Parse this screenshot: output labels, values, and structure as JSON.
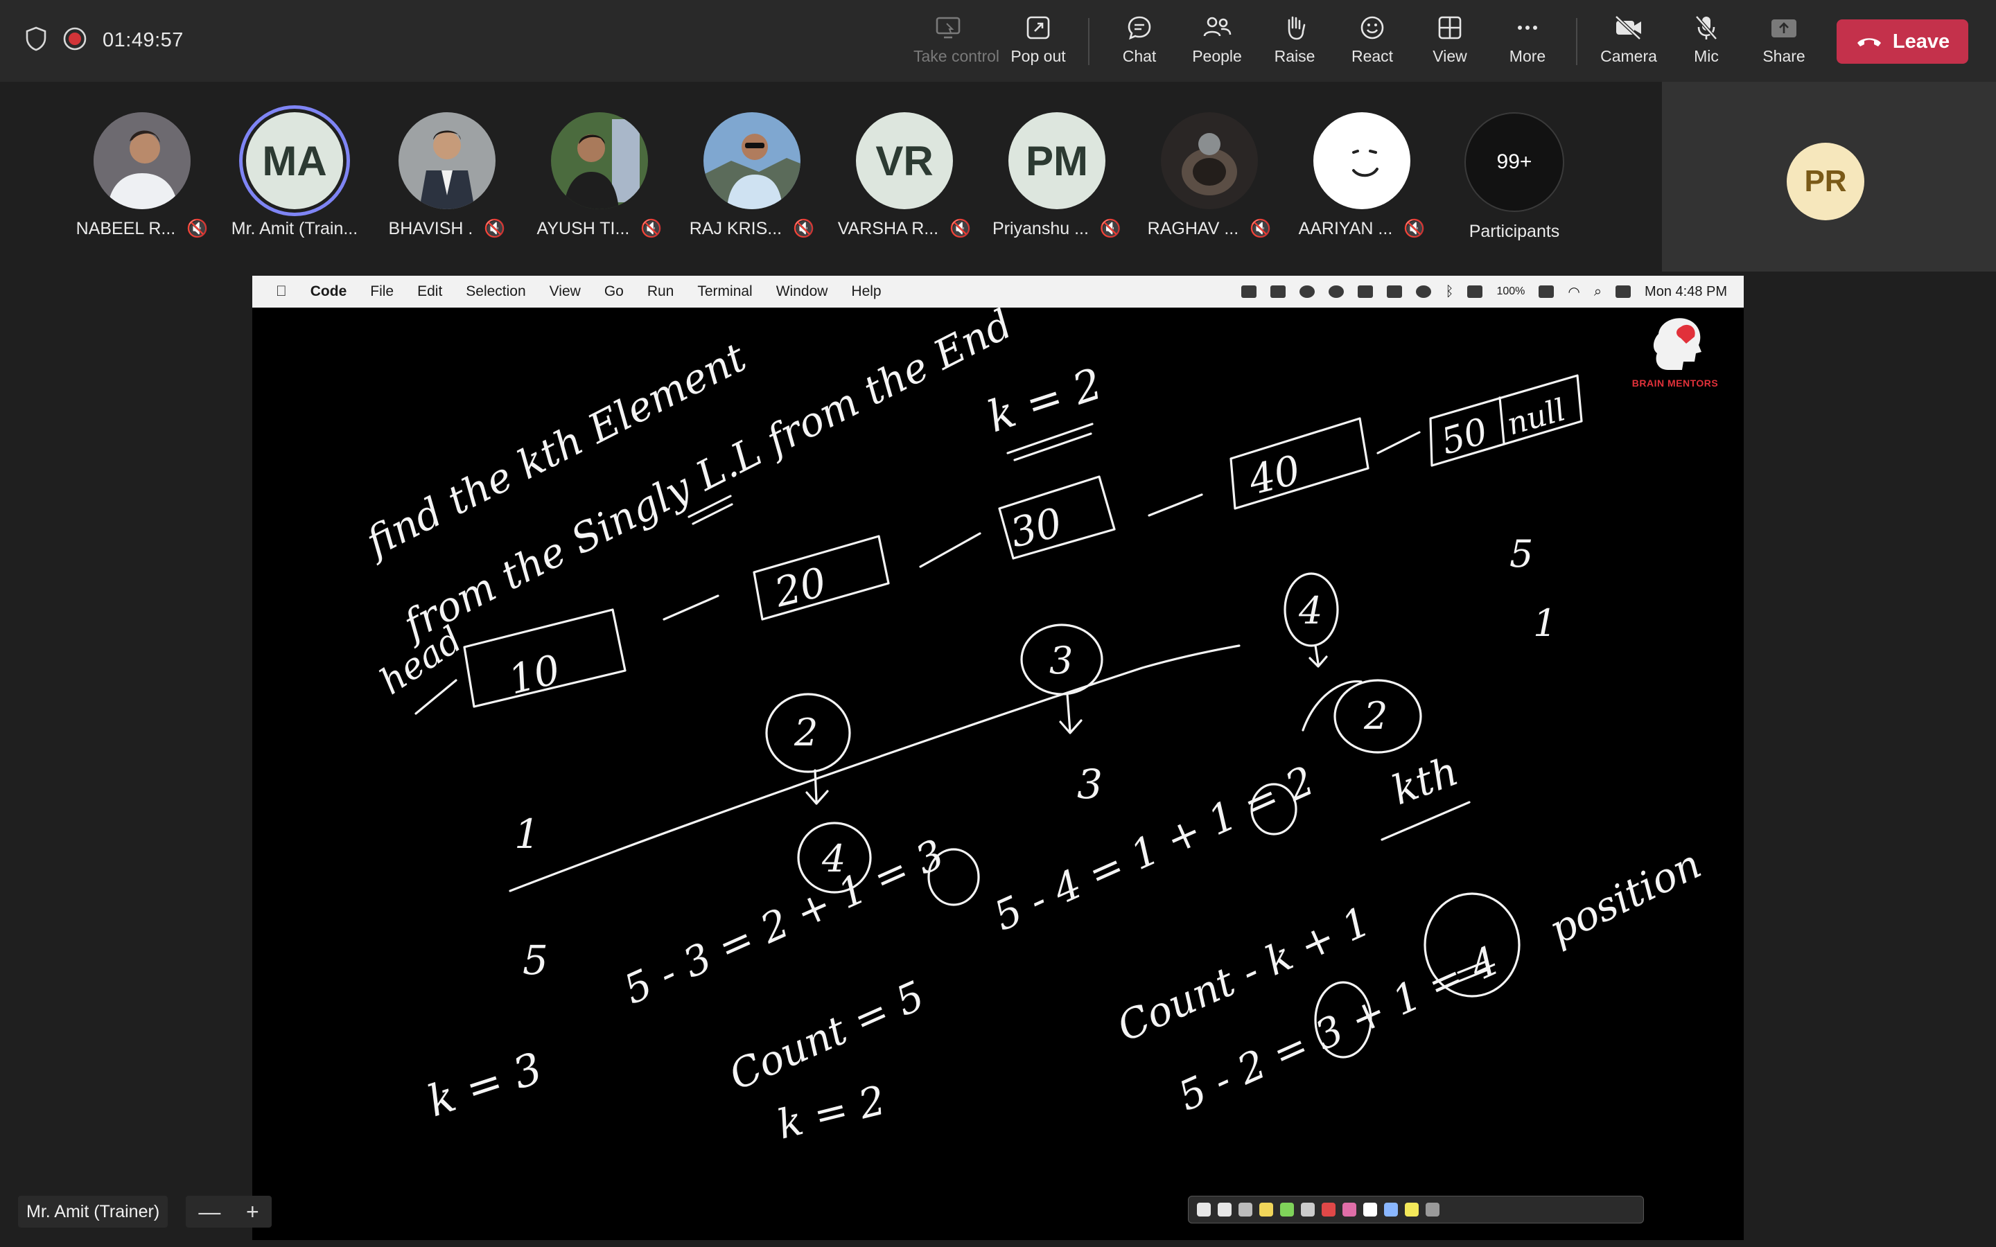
{
  "meeting": {
    "timer": "01:49:57",
    "toolbar": [
      {
        "id": "take-control",
        "label": "Take control",
        "icon": "take-control-icon",
        "disabled": true
      },
      {
        "id": "pop-out",
        "label": "Pop out",
        "icon": "pop-out-icon"
      },
      {
        "id": "chat",
        "label": "Chat",
        "icon": "chat-icon"
      },
      {
        "id": "people",
        "label": "People",
        "icon": "people-icon"
      },
      {
        "id": "raise",
        "label": "Raise",
        "icon": "raise-hand-icon"
      },
      {
        "id": "react",
        "label": "React",
        "icon": "react-icon"
      },
      {
        "id": "view",
        "label": "View",
        "icon": "view-grid-icon"
      },
      {
        "id": "more",
        "label": "More",
        "icon": "more-icon"
      },
      {
        "id": "camera",
        "label": "Camera",
        "icon": "camera-off-icon"
      },
      {
        "id": "mic",
        "label": "Mic",
        "icon": "mic-off-icon"
      },
      {
        "id": "share",
        "label": "Share",
        "icon": "share-icon",
        "disabled": true
      }
    ],
    "leave_label": "Leave",
    "accent": "#c4314b"
  },
  "participants": [
    {
      "name": "NABEEL R...",
      "initials": "",
      "muted": true
    },
    {
      "name": "Mr. Amit (Train...",
      "initials": "MA",
      "muted": false,
      "speaking": true
    },
    {
      "name": "BHAVISH .",
      "initials": "",
      "muted": true
    },
    {
      "name": "AYUSH TI...",
      "initials": "",
      "muted": true
    },
    {
      "name": "RAJ KRIS...",
      "initials": "",
      "muted": true
    },
    {
      "name": "VARSHA R...",
      "initials": "VR",
      "muted": true
    },
    {
      "name": "Priyanshu ...",
      "initials": "PM",
      "muted": true
    },
    {
      "name": "RAGHAV ...",
      "initials": "",
      "muted": true
    },
    {
      "name": "AARIYAN ...",
      "initials": "",
      "muted": true
    }
  ],
  "more_participants": {
    "count": "99+",
    "label": "Participants"
  },
  "self_view": {
    "initials": "PR"
  },
  "shared_screen": {
    "menu": [
      "Code",
      "File",
      "Edit",
      "Selection",
      "View",
      "Go",
      "Run",
      "Terminal",
      "Window",
      "Help"
    ],
    "battery": "100%",
    "clock": "Mon 4:48 PM",
    "logo_text": "BRAIN MENTORS"
  },
  "whiteboard": {
    "title_line1": "find the kth Element",
    "title_line2": "from the Singly L.L from the End",
    "k_top": "k = 2",
    "head": "head",
    "nodes": [
      "10",
      "20",
      "30",
      "40",
      "50"
    ],
    "null_label": "null",
    "circles": [
      "2",
      "3",
      "4",
      "2",
      "4"
    ],
    "side_notes": [
      "5",
      "1",
      "1",
      "3"
    ],
    "k_label": "kth",
    "eq1": "5 - 3 = 2 + 1 = 3",
    "eq2": "5 - 4 = 1 + 1 = 2",
    "count_eq": "Count = 5",
    "k_eq": "k = 2",
    "k3": "k = 3",
    "five": "5",
    "formula": "Count - k + 1",
    "formula_eq": "5 - 2 = 3 + 1 = 4",
    "position": "position"
  },
  "presenter": {
    "name": "Mr. Amit (Trainer)"
  },
  "zoom": {
    "minus": "—",
    "plus": "+"
  }
}
